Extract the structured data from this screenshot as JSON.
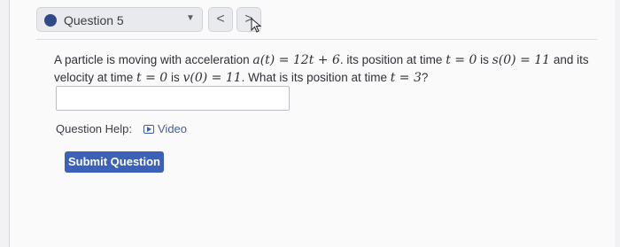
{
  "header": {
    "question_label": "Question 5",
    "dropdown_icon": "caret-down-icon",
    "prev_label": "<",
    "next_label": ">"
  },
  "problem": {
    "part1": "A particle is moving with acceleration ",
    "math1": "a(t) = 12t + 6",
    "part2": ". its position at time ",
    "math2": "t = 0",
    "part3": " is ",
    "math3": "s(0) = 11",
    "part4": " and its velocity at time ",
    "math4": "t = 0",
    "part5": " is ",
    "math5": "v(0) = 11",
    "part6": ". What is its position at time ",
    "math6": "t = 3",
    "part7": "?"
  },
  "answer": {
    "value": ""
  },
  "help": {
    "label": "Question Help:",
    "video_label": "Video"
  },
  "actions": {
    "submit_label": "Submit Question"
  },
  "colors": {
    "accent": "#3b61b8",
    "indicator": "#2f4a8a"
  }
}
